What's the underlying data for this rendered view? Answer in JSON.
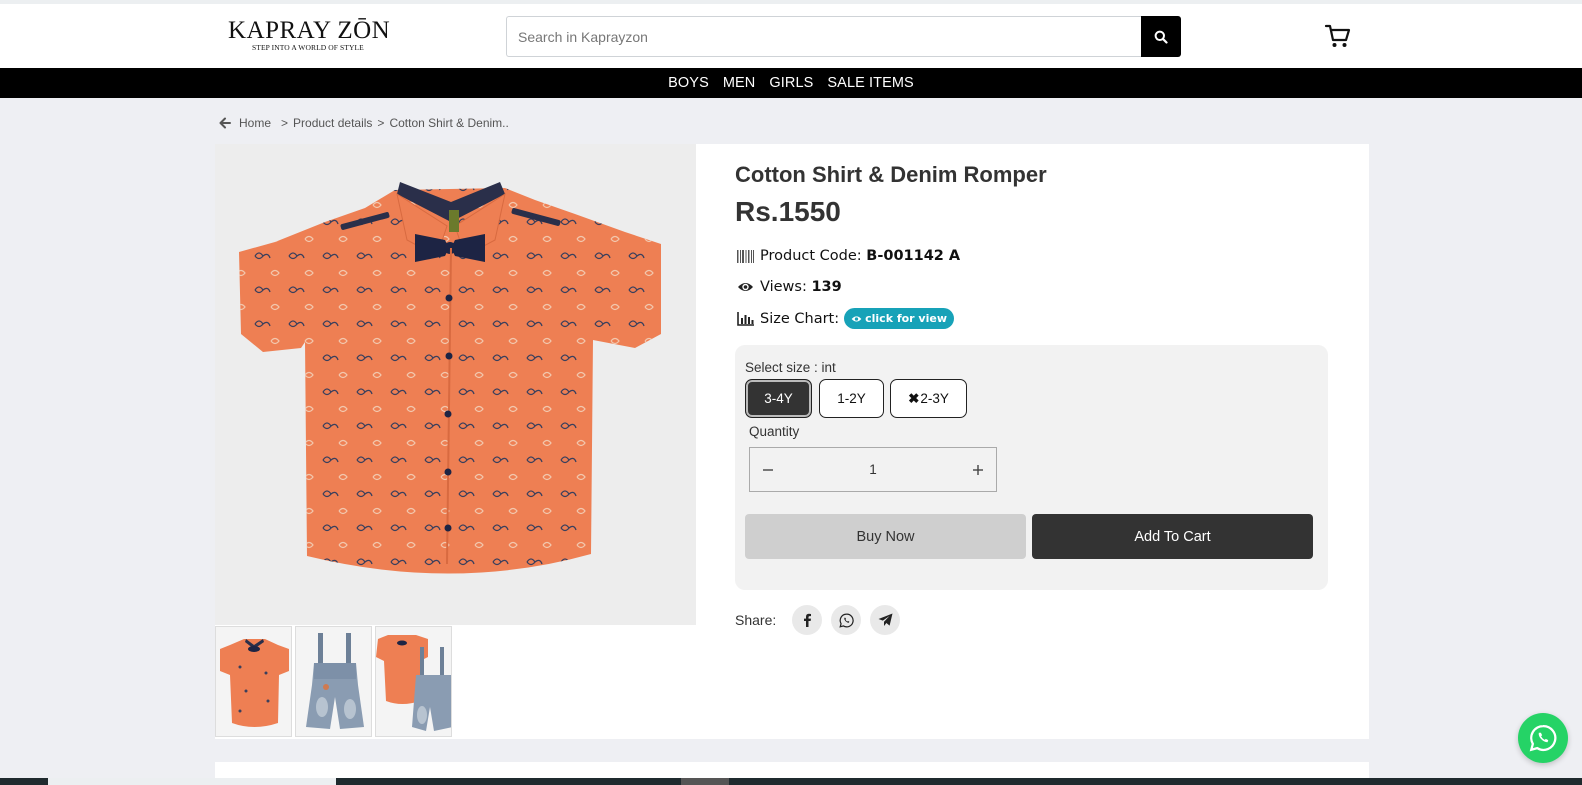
{
  "header": {
    "logo_text": "KAPRAY ZŌN",
    "logo_tagline": "STEP INTO A WORLD OF STYLE",
    "search_placeholder": "Search in Kaprayzon",
    "icons": [
      "search-icon",
      "cart-icon"
    ]
  },
  "nav": {
    "items": [
      {
        "label": "BOYS"
      },
      {
        "label": "MEN"
      },
      {
        "label": "GIRLS"
      },
      {
        "label": "SALE ITEMS"
      }
    ]
  },
  "breadcrumb": {
    "home": "Home",
    "separator": ">",
    "product_details": "Product details",
    "current": "Cotton Shirt & Denim.."
  },
  "product": {
    "title": "Cotton Shirt & Denim Romper",
    "price": "Rs.1550",
    "code_label": "Product Code:",
    "code_value": "B-001142 A",
    "views_label": "Views:",
    "views_value": "139",
    "size_chart_label": "Size Chart:",
    "size_chart_button": "click for view",
    "select_size_label": "Select size : int",
    "sizes": [
      {
        "label": "3-4Y",
        "selected": true,
        "unavailable": false
      },
      {
        "label": "1-2Y",
        "selected": false,
        "unavailable": false
      },
      {
        "label": "2-3Y",
        "selected": false,
        "unavailable": true,
        "mark": "✖"
      }
    ],
    "quantity_label": "Quantity",
    "quantity_value": "1",
    "buy_now": "Buy Now",
    "add_to_cart": "Add To Cart",
    "share_label": "Share:",
    "share_icons": [
      "facebook-icon",
      "whatsapp-icon",
      "telegram-icon"
    ],
    "thumbnails": [
      "shirt",
      "denim-romper",
      "shirt-and-romper"
    ]
  },
  "colors": {
    "accent": "#17a2b8",
    "primary_dark": "#333333",
    "nav_bg": "#000000",
    "page_bg": "#eeeff3",
    "shirt": "#ee7f53",
    "whatsapp": "#25d366"
  }
}
